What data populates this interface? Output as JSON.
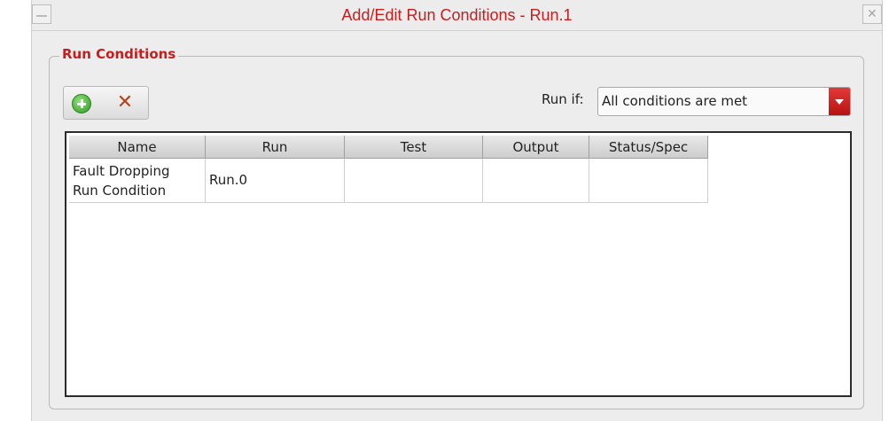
{
  "window": {
    "title": "Add/Edit Run Conditions - Run.1",
    "title_color": "#c81d1d"
  },
  "group": {
    "label": "Run Conditions"
  },
  "toolbar": {
    "add_icon": "add-icon",
    "delete_icon": "delete-icon"
  },
  "run_if": {
    "label": "Run if:",
    "selected": "All conditions are met"
  },
  "table": {
    "headers": [
      "Name",
      "Run",
      "Test",
      "Output",
      "Status/Spec"
    ],
    "rows": [
      {
        "name_line1": "Fault Dropping",
        "name_line2": "Run Condition",
        "run": "Run.0",
        "test": "",
        "output": "",
        "status": ""
      }
    ]
  }
}
